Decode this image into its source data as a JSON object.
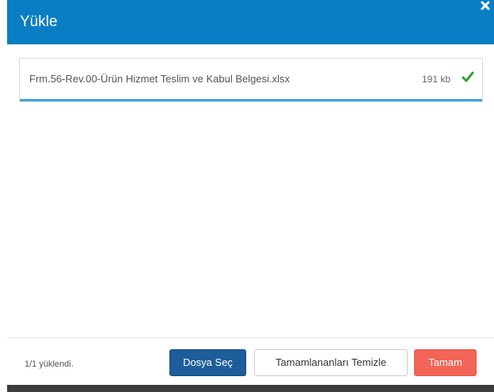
{
  "dialog": {
    "title": "Yükle",
    "header_color": "#0a7ec4"
  },
  "icons": {
    "close": "close-icon",
    "check": "check-icon"
  },
  "files": [
    {
      "name": "Frm.56-Rev.00-Ürün Hizmet Teslim ve Kabul Belgesi.xlsx",
      "size": "191 kb",
      "progress": 1.0,
      "status": "complete"
    }
  ],
  "footer": {
    "status": "1/1 yüklendi.",
    "choose_label": "Dosya Seç",
    "clear_label": "Tamamlananları Temizle",
    "ok_label": "Tamam"
  },
  "colors": {
    "primary_button": "#1d5d99",
    "ok_button": "#f26456",
    "progress": "#3ea6df",
    "check": "#2ea02e"
  }
}
